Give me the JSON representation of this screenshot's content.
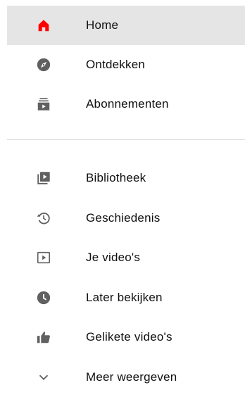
{
  "colors": {
    "accent": "#ff0000",
    "icon": "#606060",
    "active_bg": "#e5e5e5",
    "divider": "#d9d9d9"
  },
  "sidebar": {
    "primary": [
      {
        "label": "Home",
        "icon": "home-icon",
        "active": true
      },
      {
        "label": "Ontdekken",
        "icon": "compass-icon",
        "active": false
      },
      {
        "label": "Abonnementen",
        "icon": "subscriptions-icon",
        "active": false
      }
    ],
    "secondary": [
      {
        "label": "Bibliotheek",
        "icon": "library-icon"
      },
      {
        "label": "Geschiedenis",
        "icon": "history-icon"
      },
      {
        "label": "Je video's",
        "icon": "your-videos-icon"
      },
      {
        "label": "Later bekijken",
        "icon": "watch-later-icon"
      },
      {
        "label": "Gelikete video's",
        "icon": "thumbs-up-icon"
      },
      {
        "label": "Meer weergeven",
        "icon": "chevron-down-icon"
      }
    ]
  }
}
